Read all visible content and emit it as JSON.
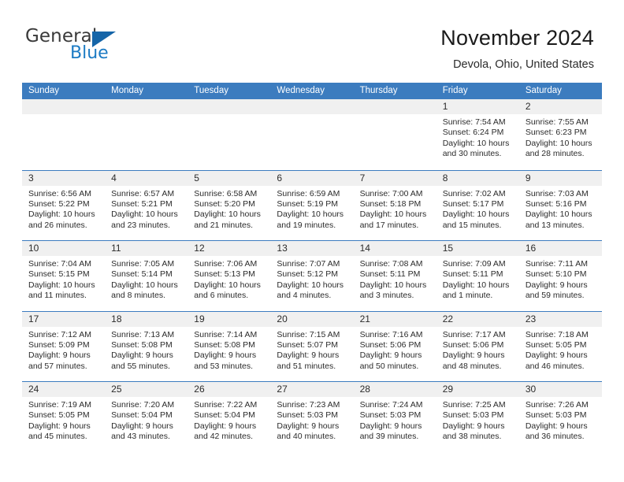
{
  "logo": {
    "word_one": "General",
    "word_two": "Blue",
    "triangle_icon": "triangle-icon"
  },
  "header": {
    "title": "November 2024",
    "subtitle": "Devola, Ohio, United States"
  },
  "colors": {
    "header_blue": "#3c7cbf",
    "logo_blue": "#1c7bc4",
    "daynum_band": "#f0f0f0",
    "text": "#2b2b2b"
  },
  "weekdays": [
    "Sunday",
    "Monday",
    "Tuesday",
    "Wednesday",
    "Thursday",
    "Friday",
    "Saturday"
  ],
  "weeks": [
    [
      {
        "day": "",
        "empty": true,
        "sunrise": "",
        "sunset": "",
        "daylight_a": "",
        "daylight_b": ""
      },
      {
        "day": "",
        "empty": true,
        "sunrise": "",
        "sunset": "",
        "daylight_a": "",
        "daylight_b": ""
      },
      {
        "day": "",
        "empty": true,
        "sunrise": "",
        "sunset": "",
        "daylight_a": "",
        "daylight_b": ""
      },
      {
        "day": "",
        "empty": true,
        "sunrise": "",
        "sunset": "",
        "daylight_a": "",
        "daylight_b": ""
      },
      {
        "day": "",
        "empty": true,
        "sunrise": "",
        "sunset": "",
        "daylight_a": "",
        "daylight_b": ""
      },
      {
        "day": "1",
        "empty": false,
        "sunrise": "Sunrise: 7:54 AM",
        "sunset": "Sunset: 6:24 PM",
        "daylight_a": "Daylight: 10 hours",
        "daylight_b": "and 30 minutes."
      },
      {
        "day": "2",
        "empty": false,
        "sunrise": "Sunrise: 7:55 AM",
        "sunset": "Sunset: 6:23 PM",
        "daylight_a": "Daylight: 10 hours",
        "daylight_b": "and 28 minutes."
      }
    ],
    [
      {
        "day": "3",
        "empty": false,
        "sunrise": "Sunrise: 6:56 AM",
        "sunset": "Sunset: 5:22 PM",
        "daylight_a": "Daylight: 10 hours",
        "daylight_b": "and 26 minutes."
      },
      {
        "day": "4",
        "empty": false,
        "sunrise": "Sunrise: 6:57 AM",
        "sunset": "Sunset: 5:21 PM",
        "daylight_a": "Daylight: 10 hours",
        "daylight_b": "and 23 minutes."
      },
      {
        "day": "5",
        "empty": false,
        "sunrise": "Sunrise: 6:58 AM",
        "sunset": "Sunset: 5:20 PM",
        "daylight_a": "Daylight: 10 hours",
        "daylight_b": "and 21 minutes."
      },
      {
        "day": "6",
        "empty": false,
        "sunrise": "Sunrise: 6:59 AM",
        "sunset": "Sunset: 5:19 PM",
        "daylight_a": "Daylight: 10 hours",
        "daylight_b": "and 19 minutes."
      },
      {
        "day": "7",
        "empty": false,
        "sunrise": "Sunrise: 7:00 AM",
        "sunset": "Sunset: 5:18 PM",
        "daylight_a": "Daylight: 10 hours",
        "daylight_b": "and 17 minutes."
      },
      {
        "day": "8",
        "empty": false,
        "sunrise": "Sunrise: 7:02 AM",
        "sunset": "Sunset: 5:17 PM",
        "daylight_a": "Daylight: 10 hours",
        "daylight_b": "and 15 minutes."
      },
      {
        "day": "9",
        "empty": false,
        "sunrise": "Sunrise: 7:03 AM",
        "sunset": "Sunset: 5:16 PM",
        "daylight_a": "Daylight: 10 hours",
        "daylight_b": "and 13 minutes."
      }
    ],
    [
      {
        "day": "10",
        "empty": false,
        "sunrise": "Sunrise: 7:04 AM",
        "sunset": "Sunset: 5:15 PM",
        "daylight_a": "Daylight: 10 hours",
        "daylight_b": "and 11 minutes."
      },
      {
        "day": "11",
        "empty": false,
        "sunrise": "Sunrise: 7:05 AM",
        "sunset": "Sunset: 5:14 PM",
        "daylight_a": "Daylight: 10 hours",
        "daylight_b": "and 8 minutes."
      },
      {
        "day": "12",
        "empty": false,
        "sunrise": "Sunrise: 7:06 AM",
        "sunset": "Sunset: 5:13 PM",
        "daylight_a": "Daylight: 10 hours",
        "daylight_b": "and 6 minutes."
      },
      {
        "day": "13",
        "empty": false,
        "sunrise": "Sunrise: 7:07 AM",
        "sunset": "Sunset: 5:12 PM",
        "daylight_a": "Daylight: 10 hours",
        "daylight_b": "and 4 minutes."
      },
      {
        "day": "14",
        "empty": false,
        "sunrise": "Sunrise: 7:08 AM",
        "sunset": "Sunset: 5:11 PM",
        "daylight_a": "Daylight: 10 hours",
        "daylight_b": "and 3 minutes."
      },
      {
        "day": "15",
        "empty": false,
        "sunrise": "Sunrise: 7:09 AM",
        "sunset": "Sunset: 5:11 PM",
        "daylight_a": "Daylight: 10 hours",
        "daylight_b": "and 1 minute."
      },
      {
        "day": "16",
        "empty": false,
        "sunrise": "Sunrise: 7:11 AM",
        "sunset": "Sunset: 5:10 PM",
        "daylight_a": "Daylight: 9 hours",
        "daylight_b": "and 59 minutes."
      }
    ],
    [
      {
        "day": "17",
        "empty": false,
        "sunrise": "Sunrise: 7:12 AM",
        "sunset": "Sunset: 5:09 PM",
        "daylight_a": "Daylight: 9 hours",
        "daylight_b": "and 57 minutes."
      },
      {
        "day": "18",
        "empty": false,
        "sunrise": "Sunrise: 7:13 AM",
        "sunset": "Sunset: 5:08 PM",
        "daylight_a": "Daylight: 9 hours",
        "daylight_b": "and 55 minutes."
      },
      {
        "day": "19",
        "empty": false,
        "sunrise": "Sunrise: 7:14 AM",
        "sunset": "Sunset: 5:08 PM",
        "daylight_a": "Daylight: 9 hours",
        "daylight_b": "and 53 minutes."
      },
      {
        "day": "20",
        "empty": false,
        "sunrise": "Sunrise: 7:15 AM",
        "sunset": "Sunset: 5:07 PM",
        "daylight_a": "Daylight: 9 hours",
        "daylight_b": "and 51 minutes."
      },
      {
        "day": "21",
        "empty": false,
        "sunrise": "Sunrise: 7:16 AM",
        "sunset": "Sunset: 5:06 PM",
        "daylight_a": "Daylight: 9 hours",
        "daylight_b": "and 50 minutes."
      },
      {
        "day": "22",
        "empty": false,
        "sunrise": "Sunrise: 7:17 AM",
        "sunset": "Sunset: 5:06 PM",
        "daylight_a": "Daylight: 9 hours",
        "daylight_b": "and 48 minutes."
      },
      {
        "day": "23",
        "empty": false,
        "sunrise": "Sunrise: 7:18 AM",
        "sunset": "Sunset: 5:05 PM",
        "daylight_a": "Daylight: 9 hours",
        "daylight_b": "and 46 minutes."
      }
    ],
    [
      {
        "day": "24",
        "empty": false,
        "sunrise": "Sunrise: 7:19 AM",
        "sunset": "Sunset: 5:05 PM",
        "daylight_a": "Daylight: 9 hours",
        "daylight_b": "and 45 minutes."
      },
      {
        "day": "25",
        "empty": false,
        "sunrise": "Sunrise: 7:20 AM",
        "sunset": "Sunset: 5:04 PM",
        "daylight_a": "Daylight: 9 hours",
        "daylight_b": "and 43 minutes."
      },
      {
        "day": "26",
        "empty": false,
        "sunrise": "Sunrise: 7:22 AM",
        "sunset": "Sunset: 5:04 PM",
        "daylight_a": "Daylight: 9 hours",
        "daylight_b": "and 42 minutes."
      },
      {
        "day": "27",
        "empty": false,
        "sunrise": "Sunrise: 7:23 AM",
        "sunset": "Sunset: 5:03 PM",
        "daylight_a": "Daylight: 9 hours",
        "daylight_b": "and 40 minutes."
      },
      {
        "day": "28",
        "empty": false,
        "sunrise": "Sunrise: 7:24 AM",
        "sunset": "Sunset: 5:03 PM",
        "daylight_a": "Daylight: 9 hours",
        "daylight_b": "and 39 minutes."
      },
      {
        "day": "29",
        "empty": false,
        "sunrise": "Sunrise: 7:25 AM",
        "sunset": "Sunset: 5:03 PM",
        "daylight_a": "Daylight: 9 hours",
        "daylight_b": "and 38 minutes."
      },
      {
        "day": "30",
        "empty": false,
        "sunrise": "Sunrise: 7:26 AM",
        "sunset": "Sunset: 5:03 PM",
        "daylight_a": "Daylight: 9 hours",
        "daylight_b": "and 36 minutes."
      }
    ]
  ]
}
